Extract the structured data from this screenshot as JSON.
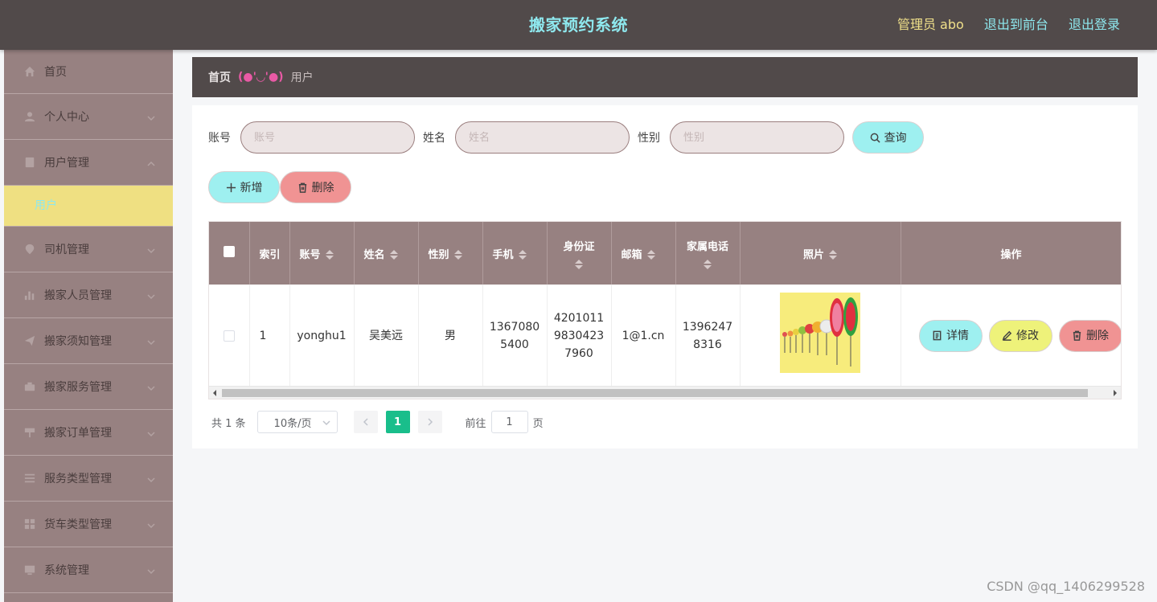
{
  "header": {
    "title": "搬家预约系统",
    "admin": "管理员 abo",
    "front_link": "退出到前台",
    "logout_link": "退出登录"
  },
  "sidebar": {
    "items": [
      {
        "label": "首页",
        "icon": "home-icon"
      },
      {
        "label": "个人中心",
        "icon": "user-icon"
      },
      {
        "label": "用户管理",
        "icon": "file-icon",
        "expanded": true,
        "children": [
          {
            "label": "用户"
          }
        ]
      },
      {
        "label": "司机管理",
        "icon": "location-icon"
      },
      {
        "label": "搬家人员管理",
        "icon": "chart-icon"
      },
      {
        "label": "搬家须知管理",
        "icon": "send-icon"
      },
      {
        "label": "搬家服务管理",
        "icon": "suitcase-icon"
      },
      {
        "label": "搬家订单管理",
        "icon": "sign-icon"
      },
      {
        "label": "服务类型管理",
        "icon": "list-icon"
      },
      {
        "label": "货车类型管理",
        "icon": "grid-icon"
      },
      {
        "label": "系统管理",
        "icon": "monitor-icon"
      }
    ]
  },
  "breadcrumb": {
    "home": "首页",
    "separator": "(●'◡'●)",
    "current": "用户"
  },
  "search": {
    "account_label": "账号",
    "account_placeholder": "账号",
    "name_label": "姓名",
    "name_placeholder": "姓名",
    "gender_label": "性别",
    "gender_placeholder": "性别",
    "search_button": "查询"
  },
  "actions": {
    "add_button": "新增",
    "delete_button": "删除"
  },
  "table": {
    "columns": [
      "索引",
      "账号",
      "姓名",
      "性别",
      "手机",
      "身份证",
      "邮箱",
      "家属电话",
      "照片",
      "操作"
    ],
    "rows": [
      {
        "index": "1",
        "account": "yonghu1",
        "name": "吴美远",
        "gender": "男",
        "phone": "13670805400",
        "id_card": "420101198304237960",
        "email": "1@1.cn",
        "family_phone": "13962478316",
        "ops": {
          "detail": "详情",
          "edit": "修改",
          "delete": "删除"
        }
      }
    ]
  },
  "pagination": {
    "total": "共 1 条",
    "page_size": "10条/页",
    "current_page": "1",
    "goto_label": "前往",
    "goto_value": "1",
    "page_suffix": "页"
  },
  "watermark": "CSDN @qq_1406299528",
  "colors": {
    "header_bg": "#514a4a",
    "title": "#8ee8ee",
    "sidebar_bg": "#978181",
    "active_submenu": "#efe082",
    "button_cyan": "#9ef0f0",
    "button_red": "#f09393",
    "button_yellow": "#eef27a",
    "page_active": "#19be8b"
  }
}
